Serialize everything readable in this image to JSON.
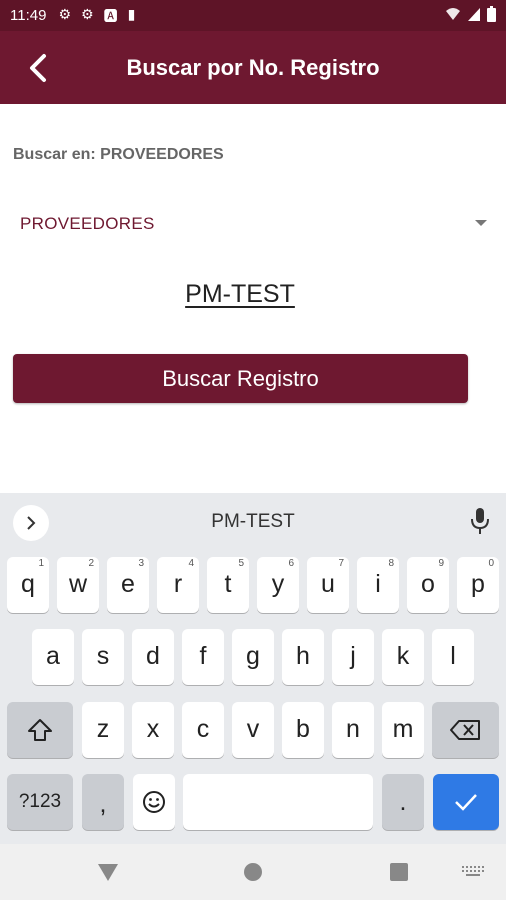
{
  "status_bar": {
    "time": "11:49"
  },
  "app_bar": {
    "title": "Buscar por No. Registro"
  },
  "search_in_label": "Buscar en: PROVEEDORES",
  "dropdown": {
    "selected": "PROVEEDORES"
  },
  "registro_input": {
    "value": "PM-TEST"
  },
  "search_button": {
    "label": "Buscar Registro"
  },
  "keyboard": {
    "suggestion": "PM-TEST",
    "row1": [
      {
        "key": "q",
        "hint": "1"
      },
      {
        "key": "w",
        "hint": "2"
      },
      {
        "key": "e",
        "hint": "3"
      },
      {
        "key": "r",
        "hint": "4"
      },
      {
        "key": "t",
        "hint": "5"
      },
      {
        "key": "y",
        "hint": "6"
      },
      {
        "key": "u",
        "hint": "7"
      },
      {
        "key": "i",
        "hint": "8"
      },
      {
        "key": "o",
        "hint": "9"
      },
      {
        "key": "p",
        "hint": "0"
      }
    ],
    "row2": [
      "a",
      "s",
      "d",
      "f",
      "g",
      "h",
      "j",
      "k",
      "l"
    ],
    "row3": [
      "z",
      "x",
      "c",
      "v",
      "b",
      "n",
      "m"
    ],
    "symbols_key": "?123",
    "comma_key": ",",
    "period_key": "."
  },
  "colors": {
    "brand": "#6e1830",
    "status_bar": "#5e1427",
    "enter_key": "#2f7ae5"
  }
}
